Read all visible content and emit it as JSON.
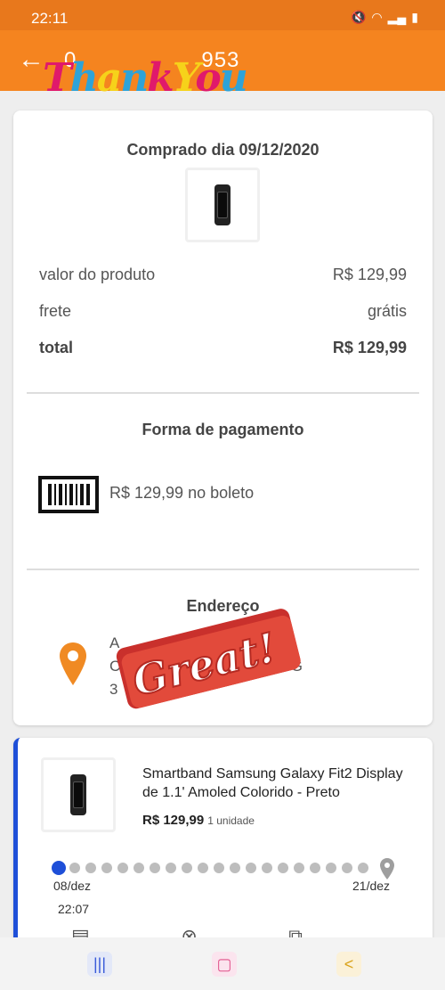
{
  "status_bar": {
    "time": "22:11",
    "icons": [
      "mute-icon",
      "wifi-icon",
      "signal-icon",
      "battery-icon"
    ]
  },
  "header": {
    "back_icon": "arrow-left-icon",
    "order_number_visible": "0",
    "order_number_tail": "953",
    "sticker_text": "Thank You"
  },
  "summary": {
    "purchased_label": "Comprado dia 09/12/2020",
    "rows": [
      {
        "label": "valor do produto",
        "value": "R$ 129,99"
      },
      {
        "label": "frete",
        "value": "grátis"
      },
      {
        "label": "total",
        "value": "R$ 129,99"
      }
    ]
  },
  "payment": {
    "title": "Forma de pagamento",
    "method": "R$ 129,99 no boleto",
    "icon": "barcode-icon"
  },
  "address": {
    "title": "Endereço",
    "line1": "A",
    "line2": "Ce",
    "line2_tail": "G",
    "line3": "3",
    "sticker_text": "Great!",
    "icon": "map-pin-icon"
  },
  "item": {
    "name": "Smartband Samsung Galaxy Fit2 Display de 1.1' Amoled Colorido - Preto",
    "price": "R$ 129,99",
    "quantity": "1 unidade",
    "timeline": {
      "start_date": "08/dez",
      "end_date": "21/dez",
      "start_time": "22:07"
    }
  },
  "colors": {
    "accent": "#f5841f",
    "status_bar": "#e8781c",
    "timeline_active": "#1e4fd8",
    "pin": "#f08a23"
  },
  "nav_bar": {
    "recents_icon": "recents-icon",
    "home_icon": "home-icon",
    "back_icon": "back-icon"
  }
}
